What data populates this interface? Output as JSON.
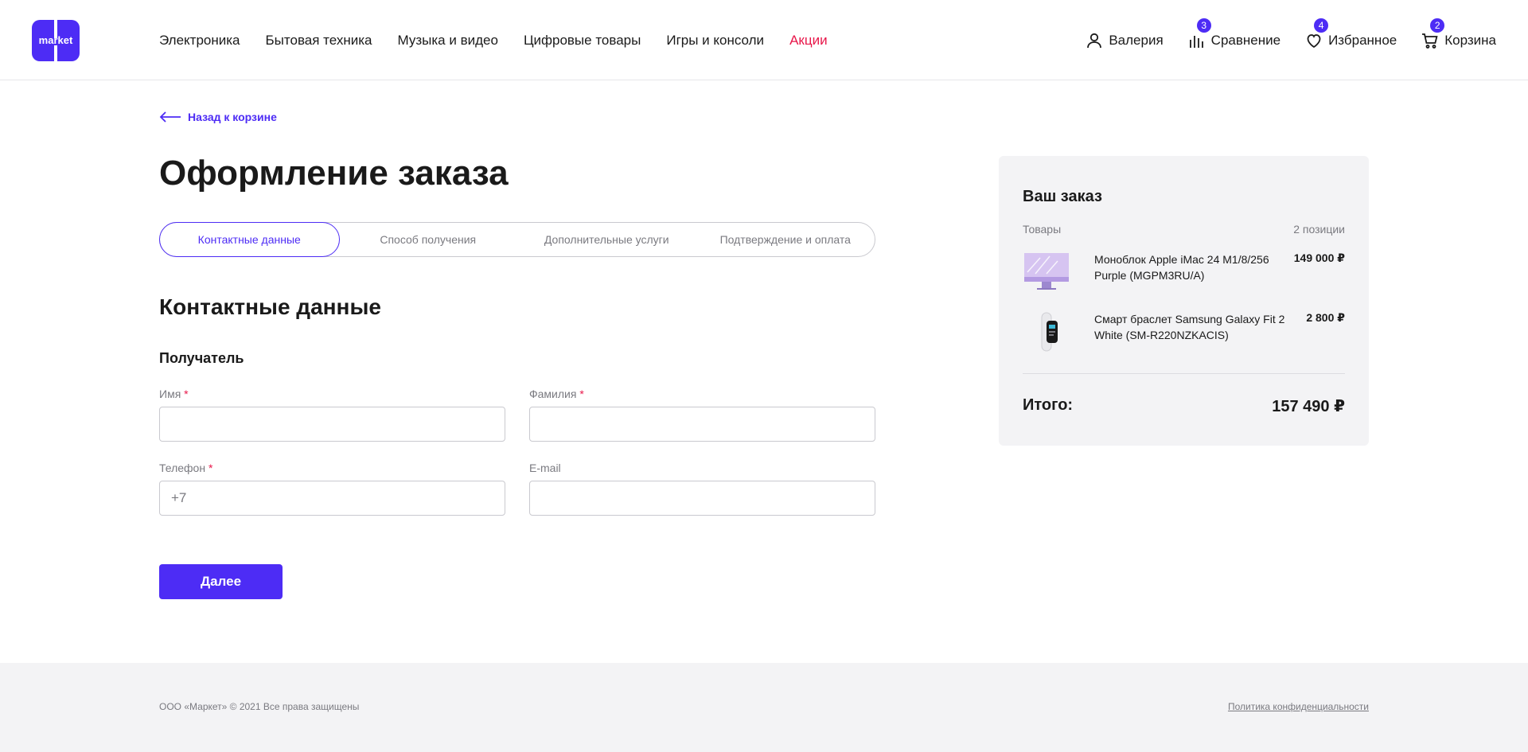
{
  "brand": {
    "logo_text": "market",
    "accent": "#4d2cf5",
    "sale_color": "#e8174a"
  },
  "nav": [
    {
      "label": "Электроника"
    },
    {
      "label": "Бытовая техника"
    },
    {
      "label": "Музыка и видео"
    },
    {
      "label": "Цифровые товары"
    },
    {
      "label": "Игры и консоли"
    },
    {
      "label": "Акции",
      "highlight": true
    }
  ],
  "user_menu": {
    "profile": {
      "label": "Валерия",
      "icon": "user-icon"
    },
    "compare": {
      "label": "Сравнение",
      "count": "3",
      "icon": "compare-icon"
    },
    "favorites": {
      "label": "Избранное",
      "count": "4",
      "icon": "heart-icon"
    },
    "cart": {
      "label": "Корзина",
      "count": "2",
      "icon": "cart-icon"
    }
  },
  "back_link": "Назад к корзине",
  "page_title": "Оформление заказа",
  "steps": [
    {
      "label": "Контактные данные",
      "active": true
    },
    {
      "label": "Способ получения"
    },
    {
      "label": "Дополнительные услуги"
    },
    {
      "label": "Подтверждение и оплата"
    }
  ],
  "form": {
    "section_title": "Контактные данные",
    "recipient_title": "Получатель",
    "required_mark": "*",
    "first_name": {
      "label": "Имя",
      "value": "",
      "placeholder": ""
    },
    "last_name": {
      "label": "Фамилия",
      "value": "",
      "placeholder": ""
    },
    "phone": {
      "label": "Телефон",
      "value": "",
      "placeholder": "+7"
    },
    "email": {
      "label": "E-mail",
      "value": "",
      "placeholder": ""
    },
    "next_label": "Далее"
  },
  "order": {
    "title": "Ваш заказ",
    "goods_label": "Товары",
    "positions": "2 позиции",
    "items": [
      {
        "name": "Моноблок Apple iMac 24 M1/8/256 Purple (MGPM3RU/A)",
        "price": "149 000 ₽"
      },
      {
        "name": "Смарт браслет Samsung Galaxy Fit 2 White (SM-R220NZKACIS)",
        "price": "2 800 ₽"
      }
    ],
    "total_label": "Итого:",
    "total_value": "157 490 ₽"
  },
  "footer": {
    "copyright": "ООО «Маркет» © 2021 Все права защищены",
    "privacy": "Политика конфиденциальности"
  }
}
